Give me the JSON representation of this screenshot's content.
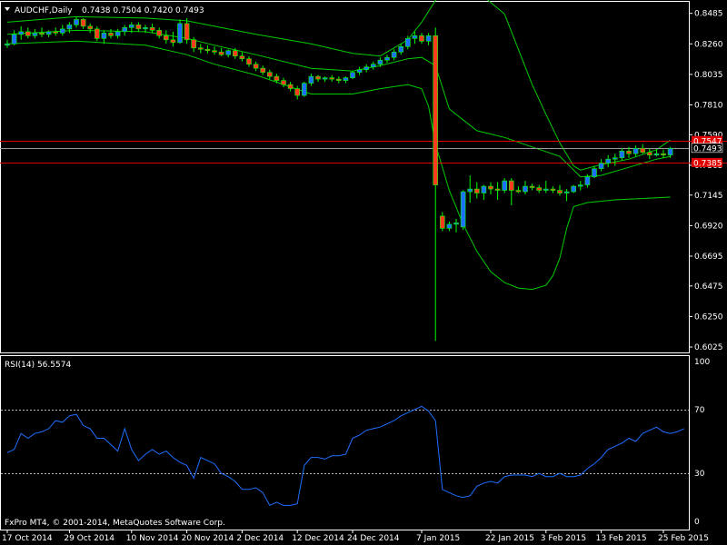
{
  "header": {
    "symbol": "AUDCHF,Daily",
    "ohlc": "0.7438 0.7504 0.7420 0.7493"
  },
  "indicator": {
    "label": "RSI(14) 56.5574"
  },
  "copyright": "FxPro MT4, © 2001-2014, MetaQuotes Software Corp.",
  "colors": {
    "background": "#000000",
    "bull_body": "#1E6FFF",
    "bear_body": "#FF3B1F",
    "wick": "#00FF00",
    "bands": "#00CC00",
    "rsi_line": "#1E6FFF",
    "level_line": "#E00000",
    "price_tag_bg": "#E00000",
    "current_price_bg": "#000000",
    "text": "#FFFFFF"
  },
  "chart_data": [
    {
      "type": "candlestick",
      "title": "AUDCHF,Daily",
      "y_axis_ticks": [
        "0.8485",
        "0.8260",
        "0.8035",
        "0.7810",
        "0.7590",
        "0.7365",
        "0.7145",
        "0.6920",
        "0.6695",
        "0.6475",
        "0.6250",
        "0.6025"
      ],
      "ylim": [
        0.5985,
        0.857
      ],
      "x_axis_ticks": [
        "17 Oct 2014",
        "29 Oct 2014",
        "10 Nov 2014",
        "20 Nov 2014",
        "2 Dec 2014",
        "12 Dec 2014",
        "24 Dec 2014",
        "7 Jan 2015",
        "22 Jan 2015",
        "3 Feb 2015",
        "13 Feb 2015",
        "25 Feb 2015"
      ],
      "x_tick_bar_index": [
        0,
        9,
        18,
        26,
        34,
        42,
        50,
        60,
        70,
        78,
        86,
        95
      ],
      "horizontal_levels": [
        {
          "value": 0.7547,
          "label": "0.7547"
        },
        {
          "value": 0.7385,
          "label": "0.7385"
        }
      ],
      "current_price": {
        "value": 0.7493,
        "label": "0.7493"
      },
      "candles": [
        [
          0.825,
          0.829,
          0.823,
          0.826
        ],
        [
          0.826,
          0.836,
          0.825,
          0.833
        ],
        [
          0.833,
          0.839,
          0.829,
          0.835
        ],
        [
          0.835,
          0.838,
          0.83,
          0.832
        ],
        [
          0.832,
          0.837,
          0.83,
          0.834
        ],
        [
          0.834,
          0.838,
          0.831,
          0.833
        ],
        [
          0.833,
          0.836,
          0.831,
          0.835
        ],
        [
          0.835,
          0.838,
          0.832,
          0.834
        ],
        [
          0.834,
          0.84,
          0.832,
          0.837
        ],
        [
          0.837,
          0.842,
          0.834,
          0.84
        ],
        [
          0.84,
          0.846,
          0.838,
          0.844
        ],
        [
          0.844,
          0.845,
          0.837,
          0.839
        ],
        [
          0.839,
          0.841,
          0.834,
          0.837
        ],
        [
          0.837,
          0.839,
          0.828,
          0.83
        ],
        [
          0.83,
          0.836,
          0.826,
          0.834
        ],
        [
          0.834,
          0.837,
          0.83,
          0.832
        ],
        [
          0.832,
          0.837,
          0.83,
          0.835
        ],
        [
          0.835,
          0.84,
          0.832,
          0.838
        ],
        [
          0.838,
          0.842,
          0.834,
          0.84
        ],
        [
          0.84,
          0.842,
          0.835,
          0.837
        ],
        [
          0.837,
          0.84,
          0.834,
          0.838
        ],
        [
          0.838,
          0.841,
          0.834,
          0.836
        ],
        [
          0.836,
          0.838,
          0.83,
          0.832
        ],
        [
          0.832,
          0.836,
          0.826,
          0.829
        ],
        [
          0.829,
          0.835,
          0.824,
          0.827
        ],
        [
          0.827,
          0.844,
          0.826,
          0.841
        ],
        [
          0.841,
          0.845,
          0.826,
          0.829
        ],
        [
          0.829,
          0.831,
          0.82,
          0.823
        ],
        [
          0.823,
          0.826,
          0.819,
          0.822
        ],
        [
          0.822,
          0.825,
          0.819,
          0.821
        ],
        [
          0.821,
          0.824,
          0.818,
          0.82
        ],
        [
          0.82,
          0.823,
          0.817,
          0.818
        ],
        [
          0.818,
          0.822,
          0.816,
          0.821
        ],
        [
          0.821,
          0.823,
          0.815,
          0.817
        ],
        [
          0.817,
          0.82,
          0.813,
          0.815
        ],
        [
          0.815,
          0.817,
          0.809,
          0.811
        ],
        [
          0.811,
          0.813,
          0.806,
          0.808
        ],
        [
          0.808,
          0.81,
          0.803,
          0.805
        ],
        [
          0.805,
          0.807,
          0.8,
          0.802
        ],
        [
          0.802,
          0.804,
          0.797,
          0.799
        ],
        [
          0.799,
          0.801,
          0.794,
          0.796
        ],
        [
          0.796,
          0.798,
          0.791,
          0.793
        ],
        [
          0.793,
          0.795,
          0.785,
          0.788
        ],
        [
          0.788,
          0.798,
          0.787,
          0.797
        ],
        [
          0.797,
          0.804,
          0.795,
          0.802
        ],
        [
          0.802,
          0.803,
          0.798,
          0.8
        ],
        [
          0.8,
          0.802,
          0.798,
          0.801
        ],
        [
          0.801,
          0.803,
          0.798,
          0.8
        ],
        [
          0.8,
          0.802,
          0.797,
          0.799
        ],
        [
          0.799,
          0.802,
          0.797,
          0.801
        ],
        [
          0.801,
          0.806,
          0.8,
          0.805
        ],
        [
          0.805,
          0.809,
          0.803,
          0.807
        ],
        [
          0.807,
          0.811,
          0.805,
          0.809
        ],
        [
          0.809,
          0.813,
          0.807,
          0.811
        ],
        [
          0.811,
          0.816,
          0.809,
          0.814
        ],
        [
          0.814,
          0.818,
          0.812,
          0.816
        ],
        [
          0.816,
          0.822,
          0.814,
          0.82
        ],
        [
          0.82,
          0.826,
          0.818,
          0.824
        ],
        [
          0.824,
          0.832,
          0.822,
          0.83
        ],
        [
          0.83,
          0.835,
          0.826,
          0.832
        ],
        [
          0.832,
          0.834,
          0.826,
          0.828
        ],
        [
          0.828,
          0.834,
          0.825,
          0.832
        ],
        [
          0.832,
          0.838,
          0.607,
          0.722
        ],
        [
          0.699,
          0.702,
          0.688,
          0.69
        ],
        [
          0.69,
          0.695,
          0.688,
          0.693
        ],
        [
          0.693,
          0.697,
          0.687,
          0.694
        ],
        [
          0.691,
          0.718,
          0.689,
          0.717
        ],
        [
          0.717,
          0.729,
          0.709,
          0.719
        ],
        [
          0.719,
          0.724,
          0.712,
          0.716
        ],
        [
          0.716,
          0.722,
          0.711,
          0.721
        ],
        [
          0.721,
          0.724,
          0.715,
          0.719
        ],
        [
          0.719,
          0.724,
          0.711,
          0.718
        ],
        [
          0.718,
          0.727,
          0.716,
          0.725
        ],
        [
          0.725,
          0.727,
          0.707,
          0.718
        ],
        [
          0.718,
          0.721,
          0.716,
          0.717
        ],
        [
          0.717,
          0.725,
          0.715,
          0.721
        ],
        [
          0.721,
          0.723,
          0.718,
          0.72
        ],
        [
          0.72,
          0.722,
          0.716,
          0.718
        ],
        [
          0.718,
          0.725,
          0.716,
          0.719
        ],
        [
          0.719,
          0.721,
          0.716,
          0.718
        ],
        [
          0.718,
          0.722,
          0.714,
          0.716
        ],
        [
          0.716,
          0.719,
          0.71,
          0.717
        ],
        [
          0.717,
          0.722,
          0.716,
          0.721
        ],
        [
          0.721,
          0.725,
          0.718,
          0.722
        ],
        [
          0.722,
          0.73,
          0.72,
          0.728
        ],
        [
          0.728,
          0.736,
          0.727,
          0.734
        ],
        [
          0.734,
          0.741,
          0.732,
          0.738
        ],
        [
          0.738,
          0.744,
          0.735,
          0.741
        ],
        [
          0.741,
          0.745,
          0.736,
          0.742
        ],
        [
          0.742,
          0.749,
          0.74,
          0.747
        ],
        [
          0.747,
          0.75,
          0.742,
          0.745
        ],
        [
          0.745,
          0.751,
          0.743,
          0.749
        ],
        [
          0.749,
          0.752,
          0.745,
          0.746
        ],
        [
          0.746,
          0.749,
          0.741,
          0.744
        ],
        [
          0.744,
          0.748,
          0.743,
          0.745
        ],
        [
          0.745,
          0.748,
          0.742,
          0.744
        ],
        [
          0.744,
          0.75,
          0.742,
          0.749
        ]
      ],
      "bands": {
        "upper": [
          [
            0,
            0.842
          ],
          [
            10,
            0.846
          ],
          [
            20,
            0.845
          ],
          [
            26,
            0.843
          ],
          [
            30,
            0.839
          ],
          [
            36,
            0.833
          ],
          [
            44,
            0.826
          ],
          [
            50,
            0.819
          ],
          [
            54,
            0.817
          ],
          [
            58,
            0.829
          ],
          [
            60,
            0.842
          ],
          [
            62,
            0.858
          ],
          [
            64,
            0.866
          ],
          [
            68,
            0.865
          ],
          [
            72,
            0.848
          ],
          [
            74,
            0.822
          ],
          [
            76,
            0.796
          ],
          [
            78,
            0.774
          ],
          [
            80,
            0.753
          ],
          [
            82,
            0.736
          ],
          [
            83,
            0.733
          ],
          [
            86,
            0.737
          ],
          [
            90,
            0.741
          ],
          [
            94,
            0.748
          ],
          [
            96,
            0.755
          ]
        ],
        "middle": [
          [
            0,
            0.833
          ],
          [
            10,
            0.836
          ],
          [
            20,
            0.835
          ],
          [
            26,
            0.83
          ],
          [
            30,
            0.825
          ],
          [
            36,
            0.818
          ],
          [
            44,
            0.808
          ],
          [
            50,
            0.806
          ],
          [
            54,
            0.81
          ],
          [
            58,
            0.815
          ],
          [
            60,
            0.816
          ],
          [
            62,
            0.81
          ],
          [
            64,
            0.778
          ],
          [
            68,
            0.762
          ],
          [
            72,
            0.757
          ],
          [
            76,
            0.75
          ],
          [
            80,
            0.743
          ],
          [
            83,
            0.728
          ],
          [
            86,
            0.729
          ],
          [
            90,
            0.735
          ],
          [
            94,
            0.741
          ],
          [
            96,
            0.743
          ]
        ],
        "lower": [
          [
            0,
            0.826
          ],
          [
            10,
            0.828
          ],
          [
            20,
            0.825
          ],
          [
            26,
            0.818
          ],
          [
            30,
            0.811
          ],
          [
            36,
            0.803
          ],
          [
            44,
            0.789
          ],
          [
            50,
            0.789
          ],
          [
            54,
            0.793
          ],
          [
            58,
            0.796
          ],
          [
            60,
            0.793
          ],
          [
            61,
            0.78
          ],
          [
            62,
            0.752
          ],
          [
            64,
            0.718
          ],
          [
            66,
            0.693
          ],
          [
            68,
            0.673
          ],
          [
            70,
            0.658
          ],
          [
            72,
            0.65
          ],
          [
            74,
            0.646
          ],
          [
            76,
            0.645
          ],
          [
            78,
            0.648
          ],
          [
            79,
            0.655
          ],
          [
            80,
            0.668
          ],
          [
            81,
            0.69
          ],
          [
            82,
            0.706
          ],
          [
            84,
            0.709
          ],
          [
            88,
            0.711
          ],
          [
            92,
            0.712
          ],
          [
            96,
            0.713
          ]
        ]
      }
    },
    {
      "type": "line",
      "title": "RSI(14) 56.5574",
      "y_axis_ticks": [
        "100",
        "70",
        "30",
        "0"
      ],
      "ylim": [
        0,
        100
      ],
      "levels": [
        70,
        30
      ],
      "series": [
        {
          "name": "RSI(14)",
          "values": [
            43,
            45,
            55,
            52,
            55,
            56,
            58,
            63,
            62,
            66,
            67,
            60,
            58,
            52,
            52,
            48,
            44,
            58,
            45,
            38,
            42,
            45,
            42,
            44,
            40,
            37,
            35,
            27,
            40,
            38,
            36,
            30,
            28,
            25,
            20,
            20,
            21,
            18,
            10,
            12,
            10,
            10,
            11,
            35,
            40,
            40,
            39,
            41,
            41,
            42,
            52,
            54,
            57,
            58,
            59,
            61,
            63,
            66,
            68,
            70,
            72,
            69,
            63,
            20,
            18,
            16,
            15,
            16,
            22,
            24,
            25,
            24,
            28,
            29,
            29,
            29,
            28,
            30,
            28,
            28,
            30,
            28,
            28,
            29,
            33,
            36,
            40,
            45,
            47,
            49,
            52,
            50,
            55,
            57,
            59,
            56,
            55,
            56,
            58
          ]
        }
      ]
    }
  ]
}
